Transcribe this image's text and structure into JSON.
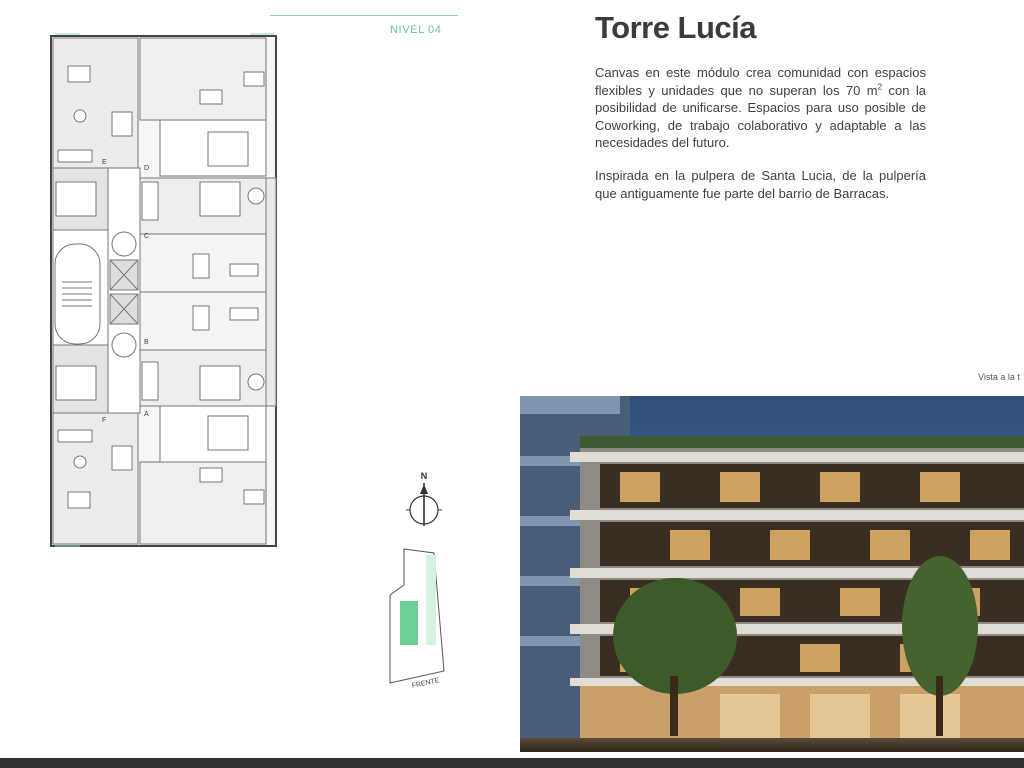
{
  "header": {
    "level_label": "NIVEL 04",
    "accent_color": "#8fd6ad"
  },
  "content": {
    "title": "Torre Lucía",
    "paragraph1_a": "Canvas en este módulo crea comunidad con espacios flexibles y unidades que no superan los 70 m",
    "paragraph1_sup": "2",
    "paragraph1_b": " con la posibilidad de unificarse. Espacios para uso posible de Coworking, de trabajo colaborativo y adaptable a las necesidades del futuro.",
    "paragraph2": "Inspirada en la pulpera de Santa Lucia, de la pulpería que antiguamente fue parte del barrio de Barracas."
  },
  "plan": {
    "unit_labels": [
      "E",
      "D",
      "C",
      "B",
      "A",
      "F"
    ],
    "compass_label": "N",
    "site_label": "FRENTE"
  },
  "render": {
    "caption": "Vista a la t"
  }
}
